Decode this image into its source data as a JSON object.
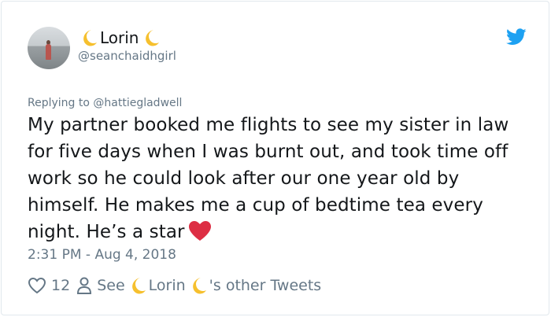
{
  "author": {
    "name": "Lorin",
    "handle": "@seanchaidhgirl",
    "name_decoration_icon": "crescent-moon-emoji"
  },
  "brand": {
    "icon": "twitter-bird-icon",
    "color": "#1da1f2"
  },
  "reply": {
    "prefix": "Replying to",
    "mention": "@hattiegladwell"
  },
  "tweet": {
    "text": "My partner booked me flights to see my sister in law\nfor five days when I was burnt out, and took time off\nwork so he could look after our one year old by\nhimself. He makes me a cup of bedtime tea every\nnight. He’s a star",
    "trailing_emoji": "red-heart-emoji"
  },
  "timestamp": "2:31 PM - Aug 4, 2018",
  "actions": {
    "like_icon": "heart-outline-icon",
    "like_count": "12",
    "see_icon": "person-icon",
    "see_prefix": "See",
    "see_name": "Lorin",
    "see_suffix": "'s other Tweets"
  },
  "colors": {
    "text": "#14171a",
    "secondary": "#657786",
    "heart": "#e0245e",
    "moon": "#f4b400"
  }
}
